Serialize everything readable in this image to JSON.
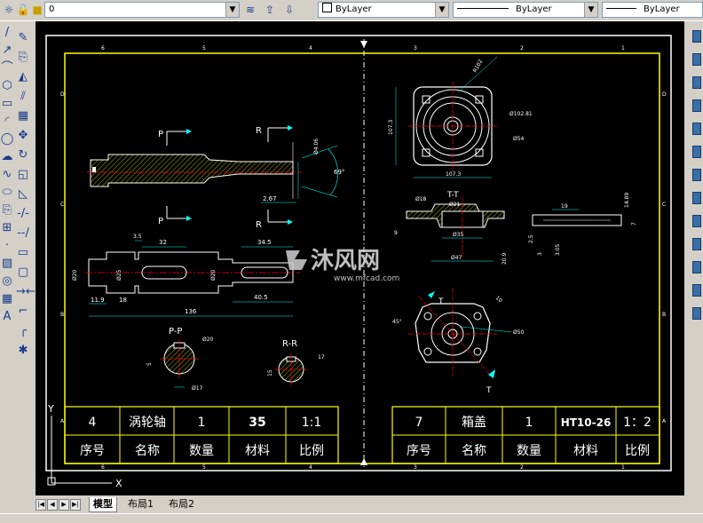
{
  "toolbar": {
    "layer_value": "0",
    "color_value": "ByLayer",
    "linetype_value": "ByLayer",
    "lineweight_value": "ByLayer"
  },
  "layout_tabs": [
    "模型",
    "布局1",
    "布局2"
  ],
  "drawing": {
    "frame_letters": [
      "D",
      "C",
      "B",
      "A"
    ],
    "frame_numbers": [
      "6",
      "5",
      "4",
      "3",
      "2",
      "1"
    ],
    "left_part": {
      "section_labels": [
        "P",
        "P",
        "R",
        "R"
      ],
      "section_titles": [
        "P-P",
        "R-R"
      ],
      "dimensions": [
        "32",
        "34.5",
        "136",
        "40.5",
        "11.9",
        "18",
        "2.67",
        "69°",
        "Ø20",
        "Ø25",
        "Ø20",
        "Ø20",
        "Ø17",
        "5",
        "17",
        "15",
        "Ø4.06",
        "3.5"
      ]
    },
    "right_part": {
      "section_labels": [
        "T-T",
        "T",
        "T"
      ],
      "dimensions": [
        "107.3",
        "107.3",
        "Ø102.81",
        "Ø54",
        "R102",
        "Ø21",
        "Ø18",
        "Ø35",
        "Ø47",
        "19",
        "14.89",
        "Ø50",
        "45°",
        "7",
        "20.9",
        "10",
        "3.05",
        "3",
        "2.5",
        "9"
      ]
    }
  },
  "title_block_left": {
    "values": [
      "4",
      "涡轮轴",
      "1",
      "35",
      "1:1"
    ],
    "headers": [
      "序号",
      "名称",
      "数量",
      "材料",
      "比例"
    ]
  },
  "title_block_right": {
    "values": [
      "7",
      "箱盖",
      "1",
      "HT10-26",
      "1：2"
    ],
    "headers": [
      "序号",
      "名称",
      "数量",
      "材料",
      "比例"
    ]
  },
  "watermark": {
    "logo_text": "沐风网",
    "url": "www.mfcad.com"
  },
  "ucs": {
    "x_label": "X",
    "y_label": "Y"
  },
  "colors": {
    "canvas_bg": "#000000",
    "line_yellow": "#ffff00",
    "line_green": "#00ff00",
    "line_white": "#ffffff",
    "center_red": "#ff0000",
    "dim_cyan": "#00ffff"
  }
}
